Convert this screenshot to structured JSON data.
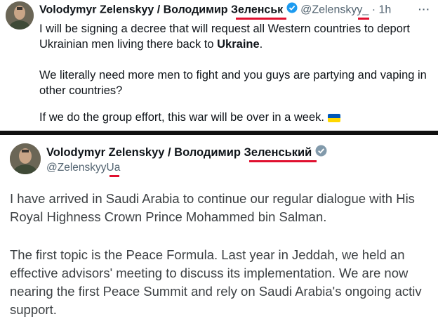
{
  "top_tweet": {
    "display_name": "Volodymyr Zelenskyy / Володимир Зеленськ",
    "handle": "@Zelenskyy_",
    "separator": "·",
    "time": "1h",
    "more": "···",
    "lines": [
      "I will be signing a decree that will request all Western countries to deport",
      "Ukrainian men living there back to ",
      "We literally need more men to fight and you guys are partying and vaping in",
      "other countries?",
      "If we do the group effort, this war will be over in a week."
    ],
    "bold_word": "Ukraine",
    "period": ".",
    "flag_icon": "ukraine-flag-icon"
  },
  "bottom_tweet": {
    "display_name": "Volodymyr Zelenskyy / Володимир Зеленський",
    "handle": "@ZelenskyyUa",
    "lines": [
      "I have arrived in Saudi Arabia to continue our regular dialogue with His",
      "Royal Highness Crown Prince Mohammed bin Salman.",
      "The first topic is the Peace Formula. Last year in Jeddah, we held an",
      "effective advisors' meeting to discuss its implementation. We are now",
      "nearing the first Peace Summit and rely on Saudi Arabia's ongoing activ",
      "support."
    ]
  },
  "colors": {
    "verified_blue": "#1d9bf0",
    "verified_gray": "#829aab",
    "underline_red": "#e0102f",
    "secondary_text": "#536471"
  }
}
